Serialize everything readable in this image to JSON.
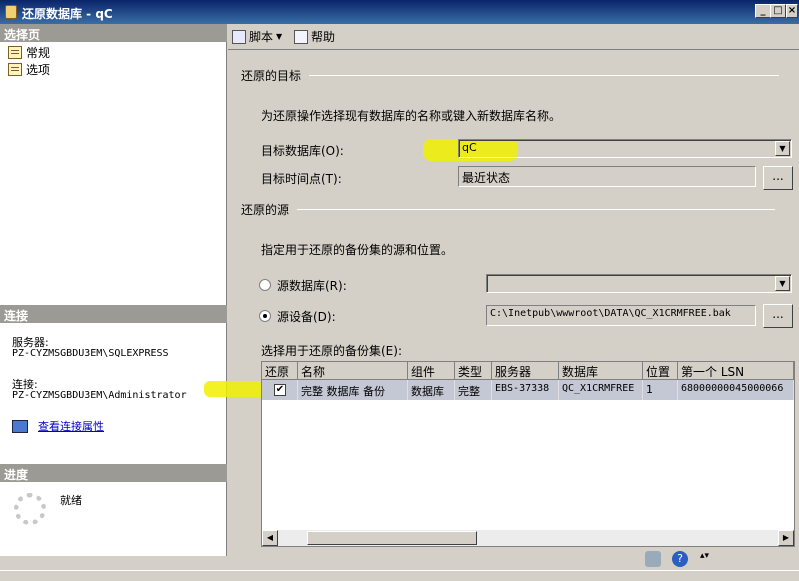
{
  "window": {
    "title": "还原数据库 - qC",
    "min": "_",
    "max": "□",
    "close": "×"
  },
  "left": {
    "select_page_header": "选择页",
    "nav_items": [
      {
        "label": "常规"
      },
      {
        "label": "选项"
      }
    ],
    "connection_header": "连接",
    "server_label": "服务器:",
    "server_value": "PZ-CYZMSGBDU3EM\\SQLEXPRESS",
    "connection_label": "连接:",
    "connection_value": "PZ-CYZMSGBDU3EM\\Administrator",
    "view_props_link": "查看连接属性",
    "progress_header": "进度",
    "progress_status": "就绪"
  },
  "toolbar": {
    "script_label": "脚本",
    "help_label": "帮助"
  },
  "restore_target": {
    "group_label": "还原的目标",
    "description": "为还原操作选择现有数据库的名称或键入新数据库名称。",
    "target_db_label": "目标数据库(O):",
    "target_db_value": "qC",
    "target_time_label": "目标时间点(T):",
    "target_time_value": "最近状态",
    "ellipsis": "..."
  },
  "restore_source": {
    "group_label": "还原的源",
    "description": "指定用于还原的备份集的源和位置。",
    "source_db_label": "源数据库(R):",
    "source_device_label": "源设备(D):",
    "source_device_value": "C:\\Inetpub\\wwwroot\\DATA\\QC_X1CRMFREE.bak",
    "ellipsis": "...",
    "backup_sets_label": "选择用于还原的备份集(E):"
  },
  "backup_table": {
    "columns": [
      "还原",
      "名称",
      "组件",
      "类型",
      "服务器",
      "数据库",
      "位置",
      "第一个 LSN"
    ],
    "rows": [
      {
        "restore": "✔",
        "name": "完整 数据库 备份",
        "component": "数据库",
        "type": "完整",
        "server": "EBS-37338",
        "database": "QC_X1CRMFREE",
        "position": "1",
        "first_lsn": "68000000045000066"
      }
    ]
  },
  "colors": {
    "highlight": "#f0f000",
    "title_bar": "#0a246a",
    "link": "#0000cc"
  }
}
